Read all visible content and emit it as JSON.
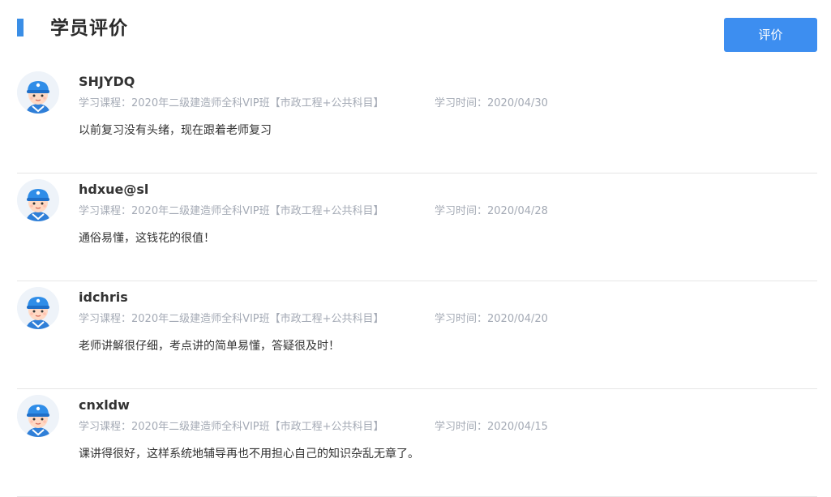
{
  "header": {
    "title": "学员评价",
    "review_button_label": "评价"
  },
  "colors": {
    "accent": "#3d8ef0",
    "meta_text": "#a4aab5",
    "divider": "#e6e6e6"
  },
  "reviews": [
    {
      "name": "SHJYDQ",
      "course": "学习课程：2020年二级建造师全科VIP班【市政工程+公共科目】",
      "time": "学习时间：2020/04/30",
      "comment": "以前复习没有头绪，现在跟着老师复习"
    },
    {
      "name": "hdxue@sl",
      "course": "学习课程：2020年二级建造师全科VIP班【市政工程+公共科目】",
      "time": "学习时间：2020/04/28",
      "comment": "通俗易懂，这钱花的很值！"
    },
    {
      "name": "idchris",
      "course": "学习课程：2020年二级建造师全科VIP班【市政工程+公共科目】",
      "time": "学习时间：2020/04/20",
      "comment": "老师讲解很仔细，考点讲的简单易懂，答疑很及时！"
    },
    {
      "name": "cnxldw",
      "course": "学习课程：2020年二级建造师全科VIP班【市政工程+公共科目】",
      "time": "学习时间：2020/04/15",
      "comment": "课讲得很好，这样系统地辅导再也不用担心自己的知识杂乱无章了。"
    }
  ]
}
